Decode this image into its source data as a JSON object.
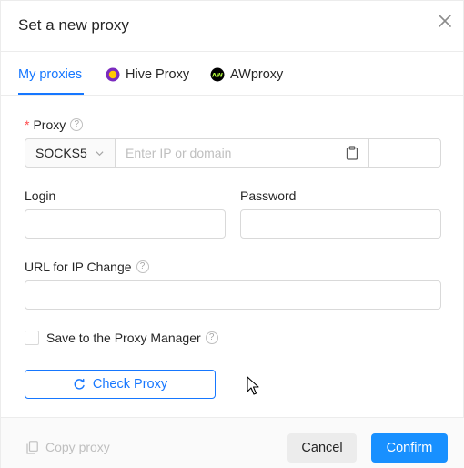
{
  "dialog": {
    "title": "Set a new proxy"
  },
  "tabs": [
    {
      "label": "My proxies",
      "active": true,
      "icon": ""
    },
    {
      "label": "Hive Proxy",
      "active": false,
      "icon": "hive-proxy-logo-icon"
    },
    {
      "label": "AWproxy",
      "active": false,
      "icon": "awproxy-logo-icon"
    }
  ],
  "form": {
    "proxy": {
      "label": "Proxy",
      "required_mark": "*",
      "protocol_value": "SOCKS5",
      "host_placeholder": "Enter IP or domain",
      "host_value": "",
      "port_value": ""
    },
    "login": {
      "label": "Login",
      "value": ""
    },
    "password": {
      "label": "Password",
      "value": ""
    },
    "ip_change_url": {
      "label": "URL for IP Change",
      "value": ""
    },
    "save_to_manager": {
      "label": "Save to the Proxy Manager",
      "checked": false
    },
    "help_glyph": "?",
    "check_button_label": "Check Proxy"
  },
  "footer": {
    "copy_label": "Copy proxy",
    "cancel_label": "Cancel",
    "confirm_label": "Confirm"
  },
  "colors": {
    "accent": "#1677ff",
    "required": "#ff4d4f",
    "hive_icon": "#7b2bbf",
    "hive_icon_ring": "#ffc800",
    "aw_icon": "#000000"
  }
}
